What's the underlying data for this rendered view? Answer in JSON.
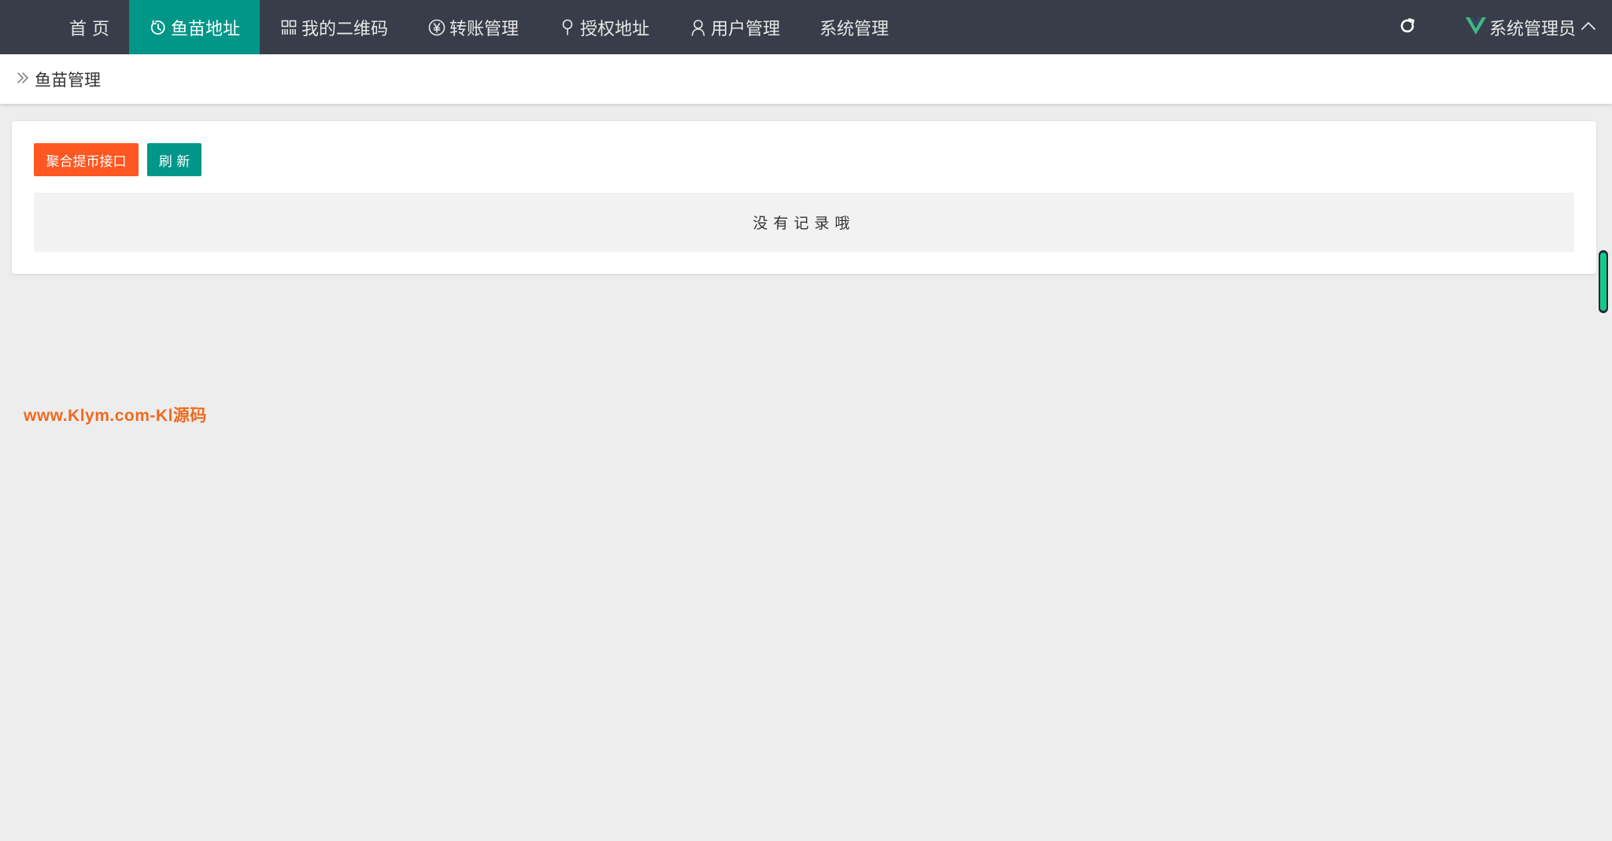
{
  "nav": {
    "items": [
      {
        "label": "首 页",
        "icon": "",
        "active": false
      },
      {
        "label": "鱼苗地址",
        "icon": "clock-icon",
        "active": true
      },
      {
        "label": "我的二维码",
        "icon": "qrcode-icon",
        "active": false
      },
      {
        "label": "转账管理",
        "icon": "yen-circle-icon",
        "active": false
      },
      {
        "label": "授权地址",
        "icon": "location-pin-icon",
        "active": false
      },
      {
        "label": "用户管理",
        "icon": "user-icon",
        "active": false
      },
      {
        "label": "系统管理",
        "icon": "",
        "active": false
      }
    ],
    "user_name": "系统管理员",
    "logo_icon": "vue-logo-icon",
    "accent_color": "#009688",
    "bar_color": "#393d49"
  },
  "breadcrumb": {
    "label": "鱼苗管理"
  },
  "toolbar": {
    "withdraw_api_label": "聚合提币接口",
    "refresh_label": "刷 新",
    "withdraw_color": "#ff5722",
    "refresh_color": "#009688"
  },
  "table": {
    "empty_text": "没有记录哦"
  },
  "watermark": {
    "text": "www.Klym.com-Kl源码"
  }
}
